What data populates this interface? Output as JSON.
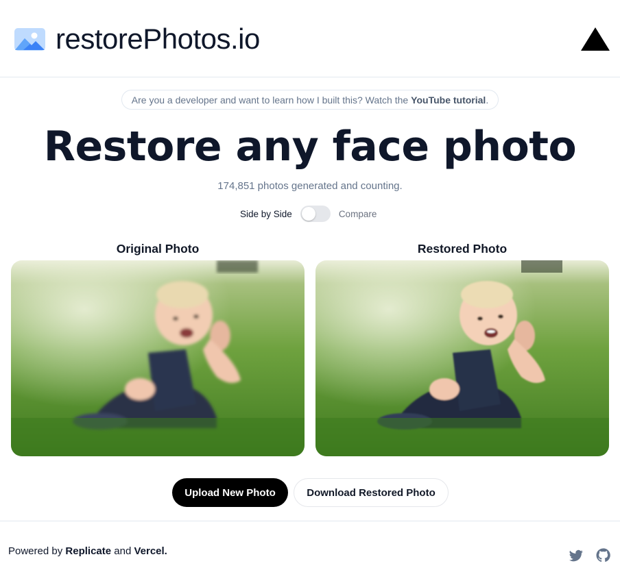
{
  "header": {
    "logo_text": "restorePhotos.io",
    "logo_icon": "photo-icon",
    "vercel_icon": "vercel-triangle-icon"
  },
  "banner": {
    "text": "Are you a developer and want to learn how I built this? Watch the",
    "link_label": "YouTube tutorial",
    "suffix": "."
  },
  "hero": {
    "title": "Restore any face photo",
    "counter": "174,851 photos generated and counting."
  },
  "toggle": {
    "left_label": "Side by Side",
    "right_label": "Compare",
    "checked": false
  },
  "photos": {
    "original_heading": "Original Photo",
    "restored_heading": "Restored Photo"
  },
  "buttons": {
    "upload_label": "Upload New Photo",
    "download_label": "Download Restored Photo"
  },
  "footer": {
    "powered_by": "Powered by",
    "replicate": "Replicate",
    "and": "and",
    "vercel": "Vercel.",
    "twitter_icon": "twitter-icon",
    "github_icon": "github-icon"
  },
  "colors": {
    "text_dark": "#0f172a",
    "muted": "#64748b",
    "border": "#e2e8f0",
    "primary_button": "#000000",
    "logo_blue": "#60a5fa"
  }
}
